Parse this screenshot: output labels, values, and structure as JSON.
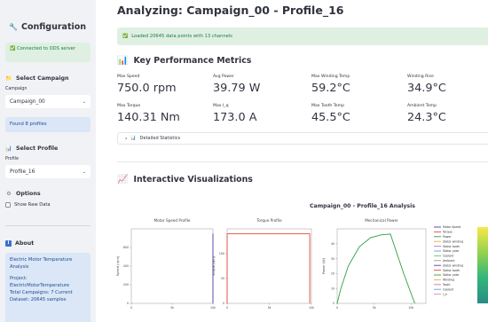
{
  "sidebar": {
    "title": "Configuration",
    "connection_status": "Connected to ODS server",
    "select_campaign": {
      "heading": "Select Campaign",
      "label": "Campaign",
      "value": "Campaign_00",
      "found": "Found 8 profiles"
    },
    "select_profile": {
      "heading": "Select Profile",
      "label": "Profile",
      "value": "Profile_16"
    },
    "options": {
      "heading": "Options",
      "show_raw": "Show Raw Data"
    },
    "about": {
      "heading": "About",
      "description": "Electric Motor Temperature Analysis",
      "project_label": "Project:",
      "project": "ElectricMotorTemperature",
      "campaigns": "Total Campaigns: 7 Current",
      "dataset": "Dataset: 20645 samples"
    }
  },
  "main": {
    "title": "Analyzing: Campaign_00 - Profile_16",
    "load_status": "Loaded 20645 data points with 13 channels",
    "kpi_heading": "Key Performance Metrics",
    "metrics": [
      {
        "label": "Max Speed",
        "value": "750.0 rpm"
      },
      {
        "label": "Avg Power",
        "value": "39.79 W"
      },
      {
        "label": "Max Winding Temp",
        "value": "59.2°C"
      },
      {
        "label": "Winding Rise",
        "value": "34.9°C"
      },
      {
        "label": "Max Torque",
        "value": "140.31 Nm"
      },
      {
        "label": "Max I_q",
        "value": "173.0 A"
      },
      {
        "label": "Max Tooth Temp",
        "value": "45.5°C"
      },
      {
        "label": "Ambient Temp",
        "value": "24.3°C"
      }
    ],
    "expander_label": "Detailed Statistics",
    "viz_heading": "Interactive Visualizations"
  },
  "figure": {
    "suptitle": "Campaign_00 - Profile_16 Analysis",
    "legend": [
      "Motor Speed",
      "Torque",
      "Power",
      "Stator winding",
      "Stator tooth",
      "Stator yoke",
      "Coolant",
      "Ambient",
      "Stator winding",
      "Stator tooth",
      "Stator yoke",
      "Winding",
      "Tooth",
      "Coolant",
      "I_d"
    ],
    "legend_colors": [
      "#4c3fb0",
      "#e8473a",
      "#2f9e3f",
      "#f0a43a",
      "#b07ad0",
      "#5aa3d8",
      "#6fbf73",
      "#999999",
      "#4c3fb0",
      "#e8473a",
      "#2f9e3f",
      "#f0a43a",
      "#b07ad0",
      "#5aa3d8",
      "#d98cb0"
    ]
  },
  "chart_data": [
    {
      "type": "line",
      "title": "Motor Speed Profile",
      "xlabel": "",
      "ylabel": "Speed (rpm)",
      "x_ticks": [
        "0",
        "5k",
        "10k"
      ],
      "y_ticks": [
        "0",
        "200",
        "400",
        "600"
      ],
      "xlim": [
        0,
        10000
      ],
      "ylim": [
        0,
        800
      ],
      "color": "#4c3fb0",
      "series": [
        {
          "x": [
            0,
            10
          ],
          "y": [
            750,
            750
          ]
        },
        {
          "x": [
            10000,
            10000
          ],
          "y": [
            750,
            0
          ]
        }
      ]
    },
    {
      "type": "line",
      "title": "Torque Profile",
      "xlabel": "",
      "ylabel": "Torque (Nm)",
      "x_ticks": [
        "0",
        "5k",
        "10k"
      ],
      "y_ticks": [
        "0",
        "50",
        "100"
      ],
      "xlim": [
        0,
        10000
      ],
      "ylim": [
        0,
        150
      ],
      "color": "#e8473a",
      "series": [
        {
          "x": [
            0,
            0,
            9800,
            9800
          ],
          "y": [
            0,
            140,
            140,
            0
          ]
        }
      ]
    },
    {
      "type": "line",
      "title": "Mechanical Power",
      "xlabel": "",
      "ylabel": "Power (W)",
      "x_ticks": [
        "0",
        "5k",
        "10k"
      ],
      "y_ticks": [
        "0",
        "10",
        "20",
        "30",
        "40"
      ],
      "xlim": [
        0,
        12000
      ],
      "ylim": [
        0,
        50
      ],
      "color": "#2f9e3f",
      "series": [
        {
          "x": [
            0,
            500,
            1500,
            3000,
            4500,
            6000,
            7200,
            9000,
            10500
          ],
          "y": [
            0,
            10,
            25,
            38,
            44,
            46,
            46.5,
            20,
            0
          ]
        }
      ]
    }
  ]
}
